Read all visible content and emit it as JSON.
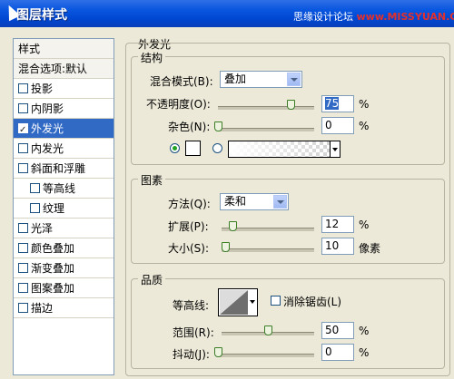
{
  "window": {
    "title": "图层样式",
    "watermark_cn": "思缘设计论坛",
    "watermark_url": "www.MISSYUAN.COM"
  },
  "sidebar": {
    "header": "样式",
    "blend_options": "混合选项:默认",
    "items": [
      {
        "label": "投影",
        "checked": false
      },
      {
        "label": "内阴影",
        "checked": false
      },
      {
        "label": "外发光",
        "checked": true,
        "selected": true
      },
      {
        "label": "内发光",
        "checked": false
      },
      {
        "label": "斜面和浮雕",
        "checked": false
      },
      {
        "label": "等高线",
        "checked": false
      },
      {
        "label": "纹理",
        "checked": false
      },
      {
        "label": "光泽",
        "checked": false
      },
      {
        "label": "颜色叠加",
        "checked": false
      },
      {
        "label": "渐变叠加",
        "checked": false
      },
      {
        "label": "图案叠加",
        "checked": false
      },
      {
        "label": "描边",
        "checked": false
      }
    ]
  },
  "panel": {
    "title": "外发光",
    "structure": {
      "title": "结构",
      "blend_mode_label": "混合模式(B):",
      "blend_mode_value": "叠加",
      "opacity_label": "不透明度(O):",
      "opacity_value": "75",
      "opacity_unit": "%",
      "opacity_level": 0.75,
      "noise_label": "杂色(N):",
      "noise_value": "0",
      "noise_unit": "%",
      "noise_level": 0
    },
    "elements": {
      "title": "图素",
      "method_label": "方法(Q):",
      "method_value": "柔和",
      "spread_label": "扩展(P):",
      "spread_value": "12",
      "spread_unit": "%",
      "spread_level": 0.12,
      "size_label": "大小(S):",
      "size_value": "10",
      "size_unit": "像素",
      "size_level": 0.04
    },
    "quality": {
      "title": "品质",
      "contour_label": "等高线:",
      "antialias_label": "消除锯齿(L)",
      "range_label": "范围(R):",
      "range_value": "50",
      "range_unit": "%",
      "range_level": 0.5,
      "jitter_label": "抖动(J):",
      "jitter_value": "0",
      "jitter_unit": "%",
      "jitter_level": 0
    }
  },
  "colors": {
    "titlebar": "#0a57e0",
    "selection": "#316ac5",
    "dialog_bg": "#ece9d8"
  }
}
